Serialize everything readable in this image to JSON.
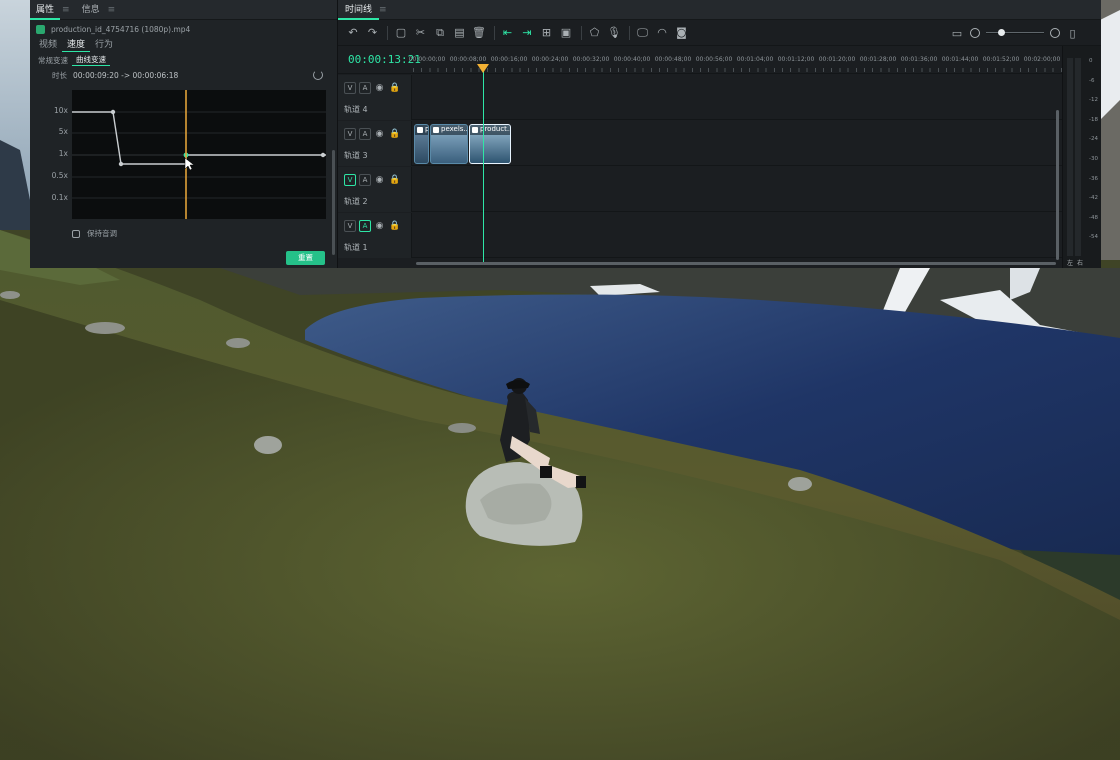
{
  "properties_panel": {
    "tabs": [
      "属性",
      "信息"
    ],
    "file_name": "production_id_4754716 (1080p).mp4",
    "subtabs": [
      "视频",
      "速度",
      "行为"
    ],
    "active_subtab": "速度",
    "modes": [
      "常规变速",
      "曲线变速"
    ],
    "active_mode": "曲线变速",
    "duration_label": "时长",
    "duration_value": "00:00:09:20 -> 00:00:06:18",
    "speed_labels": [
      "10x",
      "5x",
      "1x",
      "0.5x",
      "0.1x"
    ],
    "keep_pitch_label": "保持音调",
    "confirm_button": "重置"
  },
  "timeline_panel": {
    "tab": "时间线",
    "timecode": "00:00:13:21",
    "ruler_labels": [
      "00:00:00;00",
      "00:00:08;00",
      "00:00:16;00",
      "00:00:24;00",
      "00:00:32;00",
      "00:00:40;00",
      "00:00:48;00",
      "00:00:56;00",
      "00:01:04;00",
      "00:01:12;00",
      "00:01:20;00",
      "00:01:28;00",
      "00:01:36;00",
      "00:01:44;00",
      "00:01:52;00",
      "00:02:00;00"
    ],
    "tracks": [
      {
        "name": "轨道 4",
        "video_on": false,
        "audio_on": false
      },
      {
        "name": "轨道 3",
        "video_on": false,
        "audio_on": false
      },
      {
        "name": "轨道 2",
        "video_on": true,
        "audio_on": false
      },
      {
        "name": "轨道 1",
        "video_on": false,
        "audio_on": true
      }
    ],
    "clips": [
      {
        "label": "p",
        "track": "轨道 3"
      },
      {
        "label": "pexels...",
        "track": "轨道 3"
      },
      {
        "label": "product...",
        "track": "轨道 3",
        "selected": true
      }
    ]
  },
  "audio_meter": {
    "db_labels": [
      "0",
      "-6",
      "-12",
      "-18",
      "-24",
      "-30",
      "-36",
      "-42",
      "-48",
      "-54"
    ],
    "channels": [
      "左",
      "右"
    ]
  },
  "colors": {
    "accent": "#2ee6a6",
    "playhead": "#f2b134",
    "panel": "#1f2326",
    "graph_bg": "#0b0d0e"
  },
  "icons": [
    "undo-icon",
    "redo-icon",
    "split-icon",
    "cut-icon",
    "copy-icon",
    "paste-icon",
    "delete-icon",
    "marker-icon",
    "zoom-icon"
  ]
}
